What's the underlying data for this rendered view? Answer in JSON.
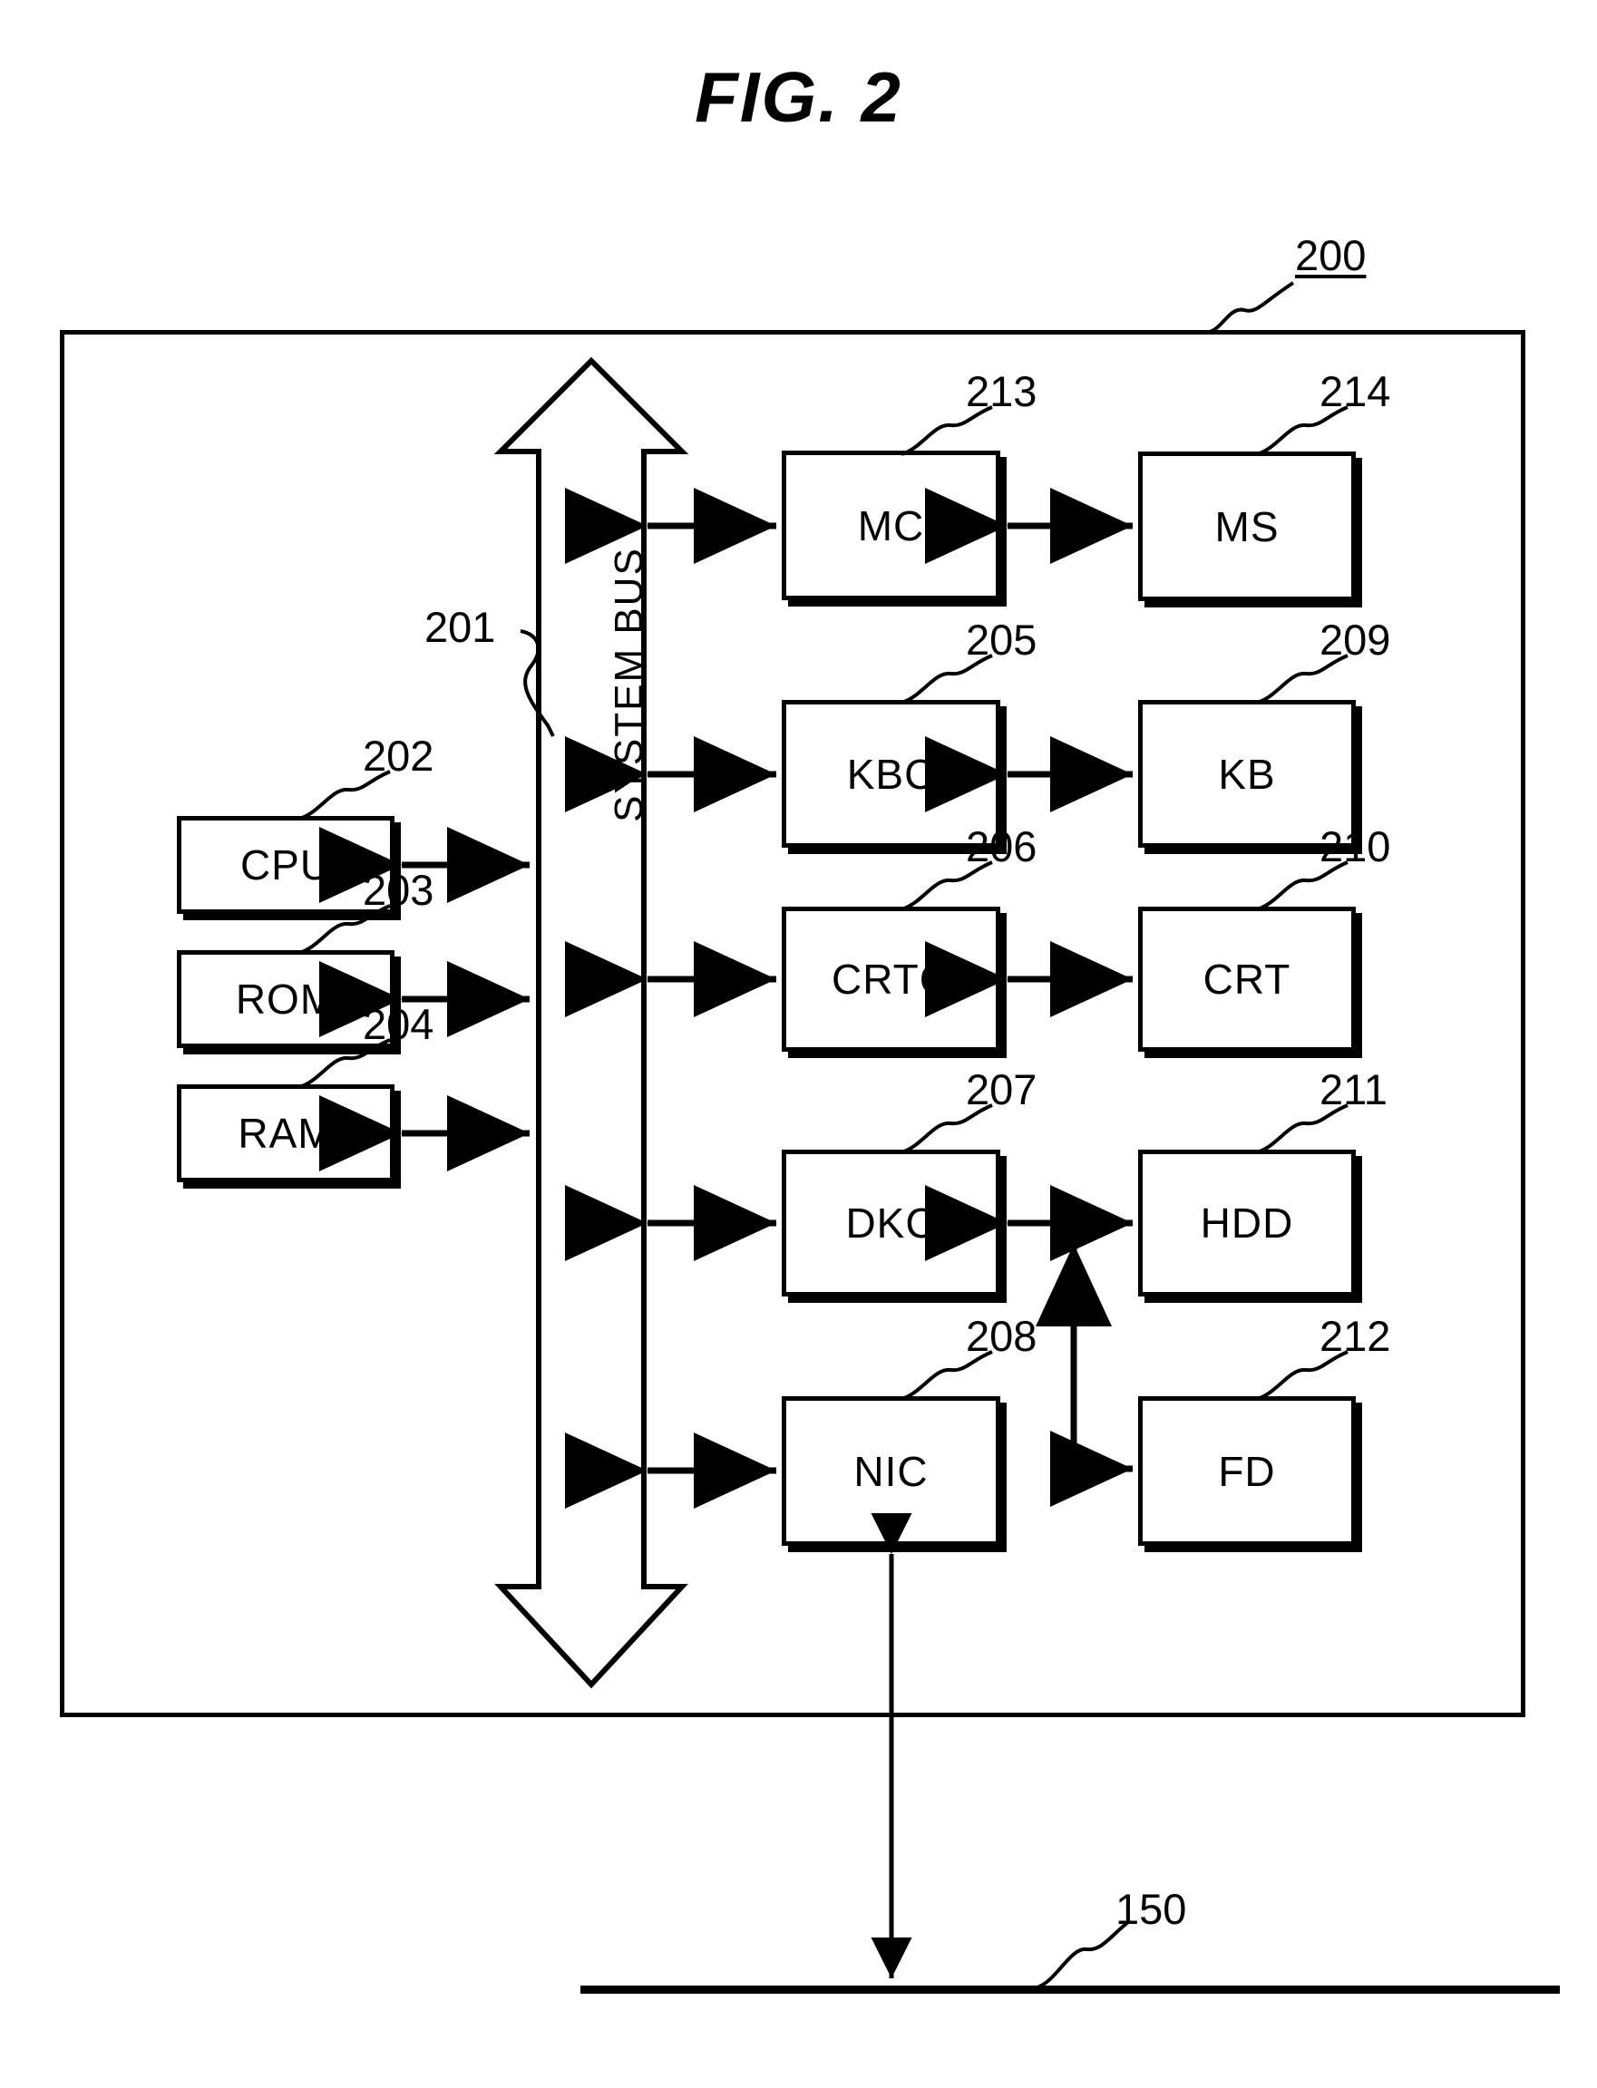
{
  "figure": {
    "title": "FIG. 2",
    "type": "patent-block-diagram",
    "system_ref": "200",
    "network_ref": "150"
  },
  "bus": {
    "label": "SYSTEM BUS",
    "ref": "201",
    "orientation": "vertical",
    "style": "double-headed-block-arrow"
  },
  "left_column": [
    {
      "label": "CPU",
      "ref": "202"
    },
    {
      "label": "ROM",
      "ref": "203"
    },
    {
      "label": "RAM",
      "ref": "204"
    }
  ],
  "controller_column": [
    {
      "label": "MC",
      "ref": "213"
    },
    {
      "label": "KBC",
      "ref": "205"
    },
    {
      "label": "CRTC",
      "ref": "206"
    },
    {
      "label": "DKC",
      "ref": "207"
    },
    {
      "label": "NIC",
      "ref": "208"
    }
  ],
  "device_column": [
    {
      "label": "MS",
      "ref": "214"
    },
    {
      "label": "KB",
      "ref": "209"
    },
    {
      "label": "CRT",
      "ref": "210"
    },
    {
      "label": "HDD",
      "ref": "211"
    },
    {
      "label": "FD",
      "ref": "212"
    }
  ],
  "colors": {
    "ink": "#000000",
    "paper": "#ffffff"
  }
}
